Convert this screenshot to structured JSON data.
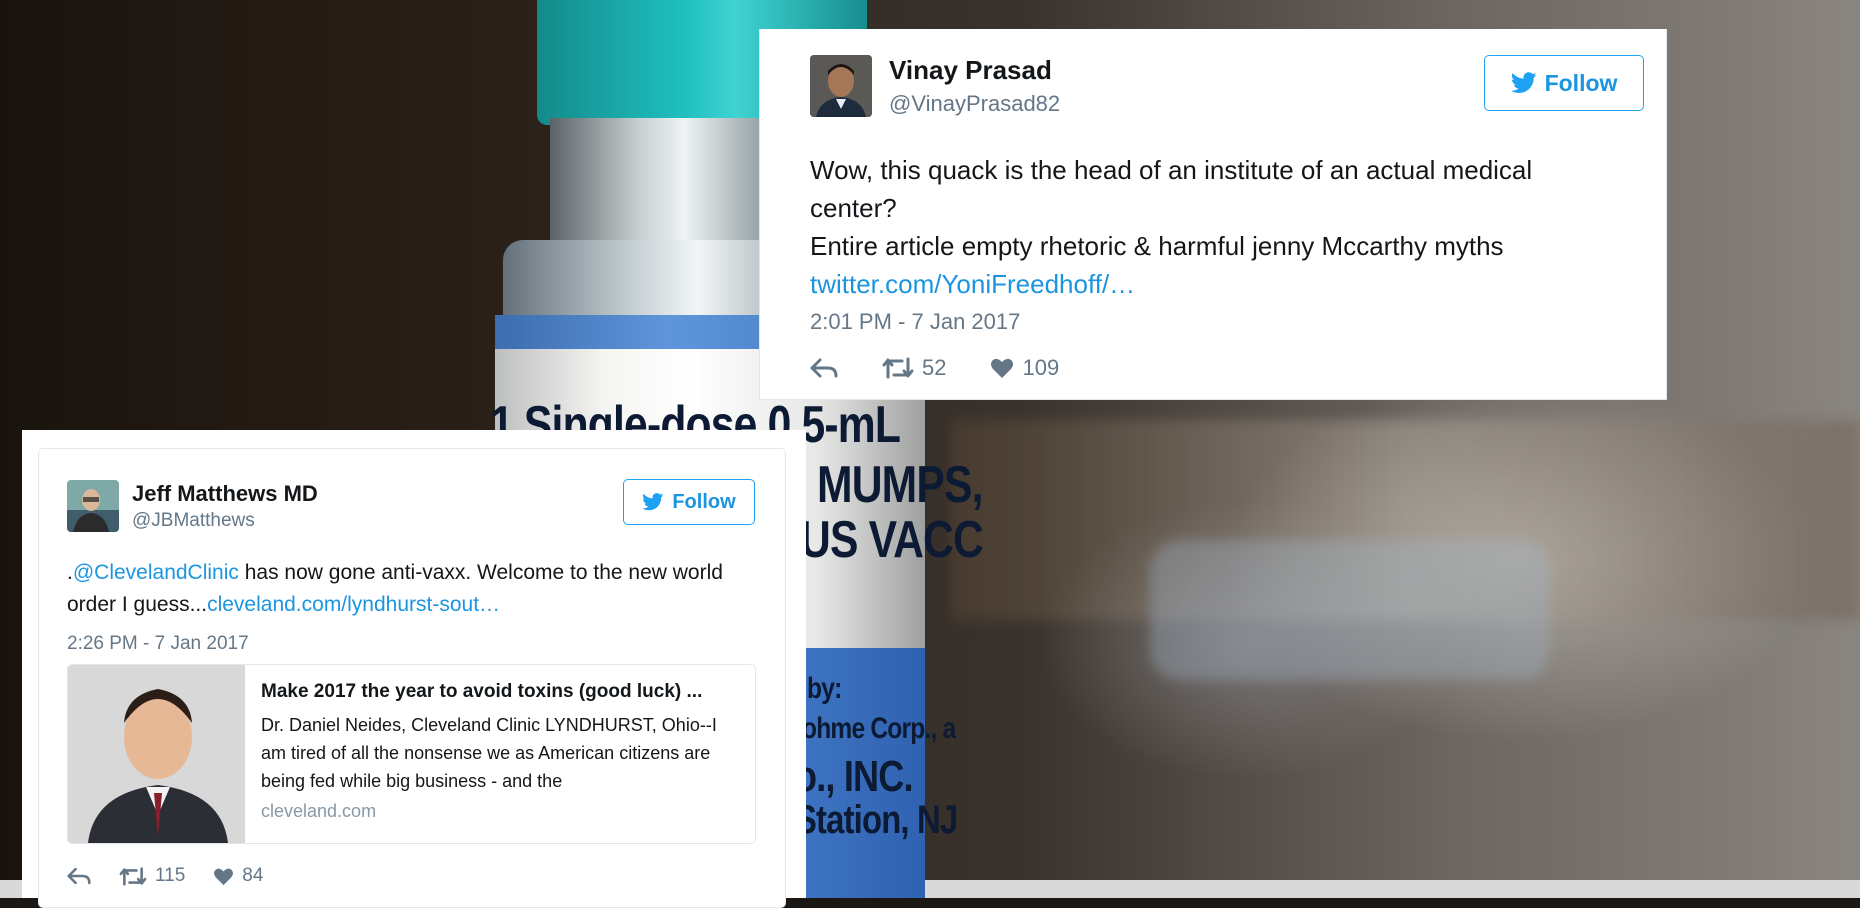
{
  "background": {
    "vial_label_lines": [
      "1 Single-dose 0.5-mL",
      "MUMPS,",
      "US VACC",
      "by:",
      "ohme Corp., a",
      "o., INC.",
      "Station, NJ"
    ],
    "cap_color": "#20c0c0",
    "label_blue": "#3e74be"
  },
  "tweets": [
    {
      "name": "Vinay Prasad",
      "handle": "@VinayPrasad82",
      "follow_label": "Follow",
      "text_lines": [
        "Wow, this quack is the head of an institute of an actual medical",
        "center?",
        "Entire article empty rhetoric & harmful jenny Mccarthy myths"
      ],
      "link": "twitter.com/YoniFreedhoff/…",
      "timestamp": "2:01 PM - 7 Jan 2017",
      "retweets": "52",
      "likes": "109"
    },
    {
      "name": "Jeff Matthews MD",
      "handle": "@JBMatthews",
      "follow_label": "Follow",
      "text_prefix": ".",
      "mention": "@ClevelandClinic",
      "text_mid": " has now gone anti-vaxx. Welcome to the new world order I guess...",
      "link": "cleveland.com/lyndhurst-sout…",
      "timestamp": "2:26 PM - 7 Jan 2017",
      "card": {
        "title": "Make 2017 the year to avoid toxins (good luck) ...",
        "description": "Dr. Daniel Neides, Cleveland Clinic  LYNDHURST, Ohio--I am tired of all the nonsense we as American citizens are being fed while big business - and the",
        "domain": "cleveland.com"
      },
      "retweets": "115",
      "likes": "84"
    }
  ],
  "colors": {
    "accent": "#1da1f2",
    "link": "#1b95e0",
    "muted": "#657786",
    "text": "#14171a"
  },
  "icons": [
    "twitter-bird-icon",
    "reply-icon",
    "retweet-icon",
    "heart-icon"
  ]
}
